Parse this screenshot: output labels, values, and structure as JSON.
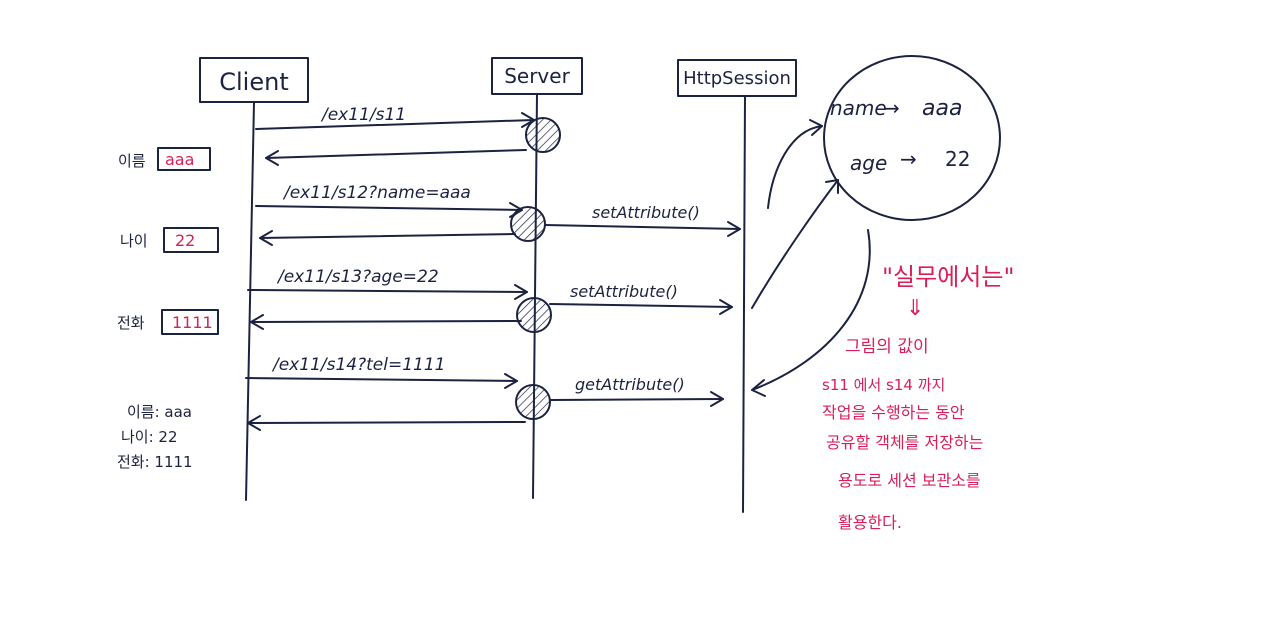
{
  "actors": {
    "client": "Client",
    "server": "Server",
    "session": "HttpSession"
  },
  "requests": [
    {
      "label": "/ex11/s11"
    },
    {
      "label": "/ex11/s12?name=aaa"
    },
    {
      "label": "/ex11/s13?age=22"
    },
    {
      "label": "/ex11/s14?tel=1111"
    }
  ],
  "session_calls": [
    "setAttribute()",
    "setAttribute()",
    "getAttribute()"
  ],
  "forms": [
    {
      "label": "이름",
      "value": "aaa"
    },
    {
      "label": "나이",
      "value": "22"
    },
    {
      "label": "전화",
      "value": "1111"
    }
  ],
  "result": [
    "이름: aaa",
    "나이: 22",
    "전화: 1111"
  ],
  "session_store": [
    {
      "key": "name",
      "value": "aaa"
    },
    {
      "key": "age",
      "value": "22"
    }
  ],
  "note": {
    "heading": "\"실무에서는\"",
    "lines": [
      "그림의 값이",
      "s11 에서  s14 까지",
      "작업을 수행하는 동안",
      "공유할 객체를 저장하는",
      "용도로 세션 보관소를",
      "활용한다."
    ]
  },
  "colors": {
    "ink": "#1c2340",
    "accent": "#d81f5a"
  }
}
